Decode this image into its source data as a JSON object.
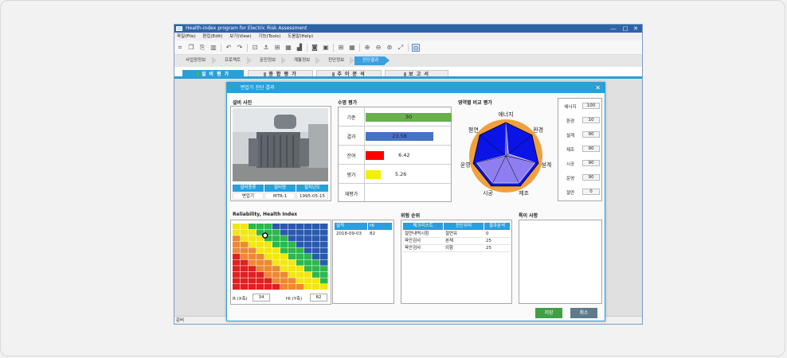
{
  "app": {
    "title": "Health-index program for Electric Risk Assessment",
    "window_controls": {
      "minimize": "—",
      "maximize": "□",
      "close": "✕"
    },
    "menus": [
      "파일(File)",
      "편집(Edit)",
      "보기(View)",
      "기능(Tools)",
      "도움말(Help)"
    ],
    "toolbar_icons": [
      "crop-icon",
      "copy-icon",
      "save-icon",
      "delete-icon",
      "undo-icon",
      "redo-icon",
      "tool-a-icon",
      "tool-b-icon",
      "tool-c-icon",
      "tool-d-icon",
      "tool-e-icon",
      "bag-icon",
      "layout-a-icon",
      "layout-b-icon",
      "grid-icon",
      "zoom-in-icon",
      "zoom-out-icon",
      "zoom-reset-icon",
      "fullscreen-icon",
      "zoom-search-icon"
    ],
    "steps": [
      {
        "label": "사업장정보",
        "active": false
      },
      {
        "label": "프로젝트",
        "active": false
      },
      {
        "label": "문진정보",
        "active": false
      },
      {
        "label": "계통정보",
        "active": false
      },
      {
        "label": "진단정보",
        "active": false
      },
      {
        "label": "진단결과",
        "active": true
      }
    ],
    "tabs": [
      "설 비 평 가",
      "종 합 평 가",
      "추 이 분 석",
      "보 고 서"
    ],
    "status": "준비",
    "colors": {
      "accent": "#2a9fd8",
      "title_bar": "#2f63a8"
    }
  },
  "dialog": {
    "title": "변압기 진단 결과",
    "close": "✕",
    "photo_section": {
      "title": "설비 사진",
      "table_headers": [
        "설비종류",
        "설비명",
        "설치년도"
      ],
      "table_values": [
        "변압기",
        "MTR-1",
        "1995-05-15"
      ]
    },
    "eval_section": {
      "title": "수명 평가",
      "rows": [
        {
          "label": "기준",
          "value": "30",
          "num": 30,
          "color": "#6ab04c",
          "centered": true
        },
        {
          "label": "결과",
          "value": "23.58",
          "num": 23.58,
          "color": "#4472c4",
          "centered": true
        },
        {
          "label": "잔여",
          "value": "6.42",
          "num": 6.42,
          "color": "#ff0000",
          "centered": false
        },
        {
          "label": "평가",
          "value": "5.26",
          "num": 5.26,
          "color": "#f0f000",
          "centered": false
        },
        {
          "label": "재평가",
          "value": "",
          "num": 0,
          "color": "#ffffff",
          "centered": false
        }
      ]
    },
    "radar_section": {
      "title": "영역별 비교 평가",
      "axes": [
        "에너지",
        "환경",
        "설계",
        "제조",
        "시공",
        "운영",
        "절연"
      ],
      "values": [
        100,
        10,
        90,
        90,
        90,
        90,
        0
      ],
      "colors": {
        "outer": "#f0a040",
        "fill": "#0a14e6",
        "inner": "#8f7ef0"
      }
    },
    "indices": [
      {
        "label": "에너지",
        "value": "100"
      },
      {
        "label": "환경",
        "value": "10"
      },
      {
        "label": "설계",
        "value": "90"
      },
      {
        "label": "제조",
        "value": "90"
      },
      {
        "label": "시공",
        "value": "90"
      },
      {
        "label": "운영",
        "value": "90"
      },
      {
        "label": "절연",
        "value": "0"
      }
    ],
    "rh_section": {
      "title": "Reliability, Health Index",
      "r_label": "R (X축)",
      "r_value": "34",
      "hi_label": "HI (Y축)",
      "hi_value": "82",
      "history_headers": [
        "실적",
        "HI"
      ],
      "history_rows": [
        [
          "2018-09-03",
          "82"
        ]
      ]
    },
    "risk_section": {
      "title": "위험 순위",
      "headers": [
        "체크리스트",
        "진단위치",
        "결과분석"
      ],
      "rows": [
        [
          "절연내력시험",
          "절연유",
          "0"
        ],
        [
          "육안검사",
          "본체",
          "25"
        ],
        [
          "육안검사",
          "외함",
          "25"
        ]
      ]
    },
    "notes_section": {
      "title": "특이 사항",
      "content": ""
    },
    "buttons": {
      "save": "저장",
      "cancel": "취소"
    }
  }
}
